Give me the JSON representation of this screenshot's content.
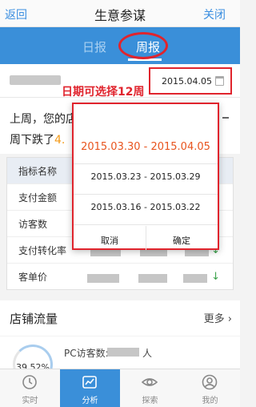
{
  "topbar": {
    "back_label": "返回",
    "title": "生意参谋",
    "close_label": "关闭"
  },
  "tabs": [
    {
      "label": "日报"
    },
    {
      "label": "周报"
    }
  ],
  "date": {
    "value": "2015.04.05"
  },
  "annotation": {
    "text": "日期可选择12周"
  },
  "summary": {
    "line1": "上周，您的店",
    "line2": "周下跌了",
    "line2_value": "4."
  },
  "table": {
    "rows": [
      {
        "label": "指标名称"
      },
      {
        "label": "支付金额"
      },
      {
        "label": "访客数"
      },
      {
        "label": "支付转化率"
      },
      {
        "label": "客单价"
      }
    ],
    "down_arrow": "↓"
  },
  "traffic": {
    "title": "店铺流量",
    "more_label": "更多 ›",
    "pc_label": "PC访客数:",
    "pc_unit": "人",
    "percent": "39.52%"
  },
  "picker": {
    "selected": "2015.03.30 - 2015.04.05",
    "options": [
      "2015.03.23 - 2015.03.29",
      "2015.03.16 - 2015.03.22"
    ],
    "cancel_label": "取消",
    "confirm_label": "确定"
  },
  "bottomnav": [
    {
      "label": "实时",
      "icon": "clock-icon"
    },
    {
      "label": "分析",
      "icon": "trend-chart-icon",
      "active": true
    },
    {
      "label": "探索",
      "icon": "eye-icon"
    },
    {
      "label": "我的",
      "icon": "user-icon"
    }
  ],
  "colors": {
    "accent": "#3a8fd9",
    "annotation_red": "#e0242d",
    "selected_orange": "#e8541e",
    "down_green": "#3aa14a"
  }
}
